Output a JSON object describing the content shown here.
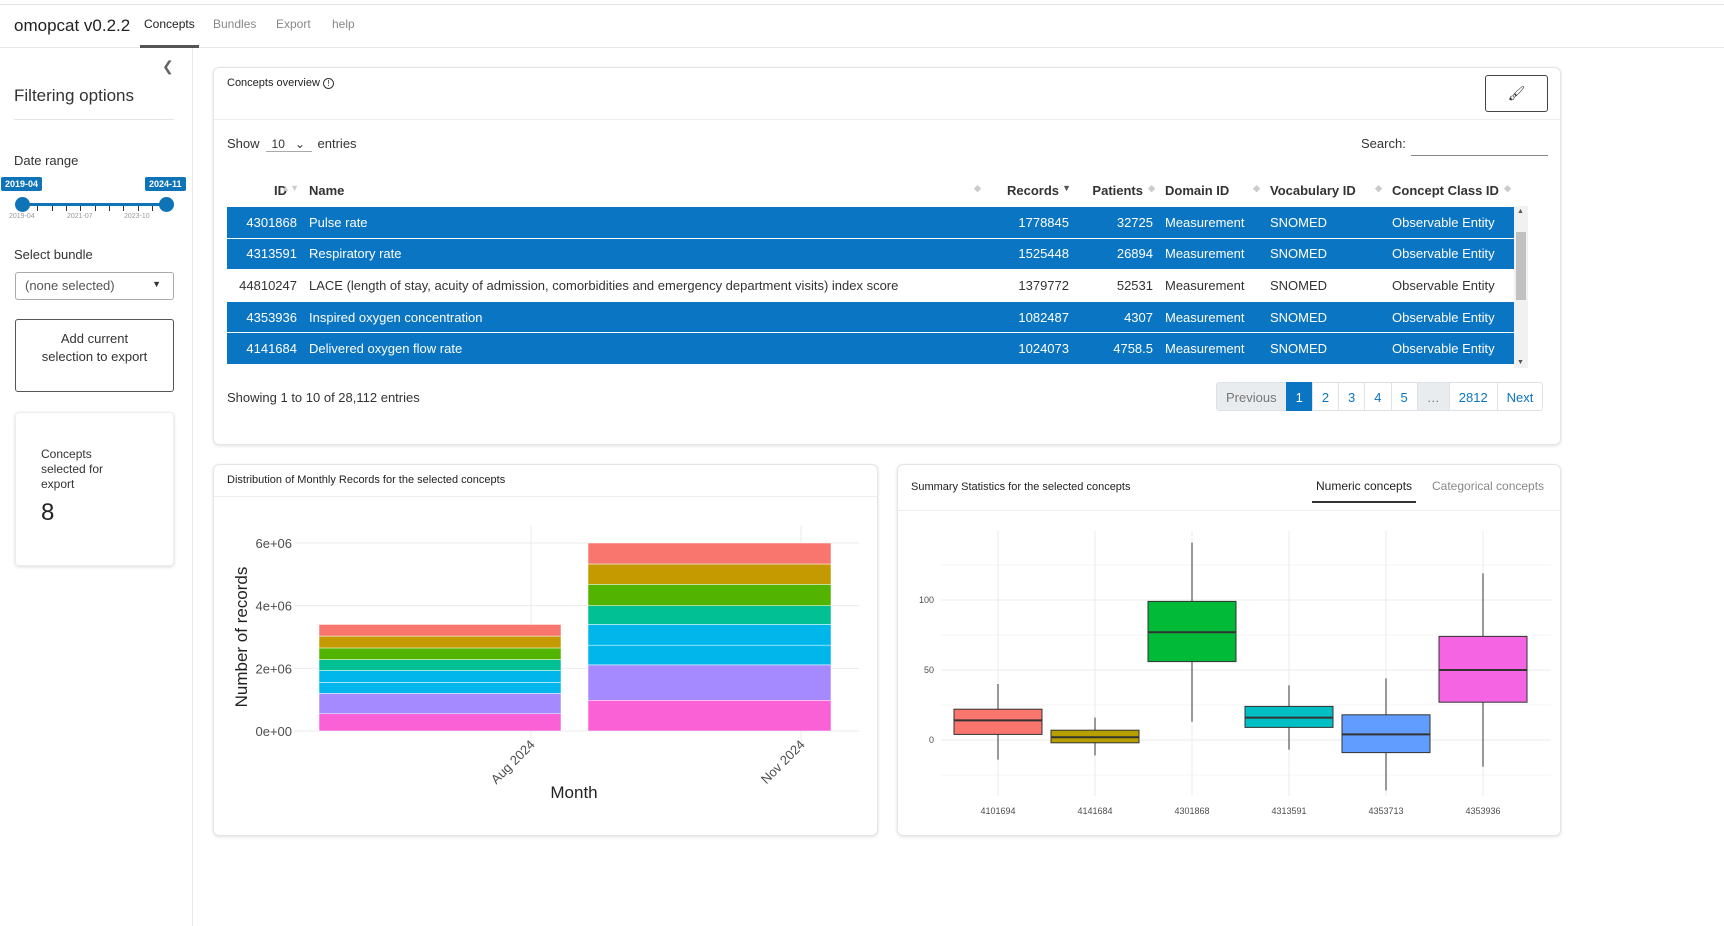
{
  "app": {
    "title": "omopcat v0.2.2",
    "tabs": [
      "Concepts",
      "Bundles",
      "Export",
      "help"
    ],
    "active_tab": "Concepts"
  },
  "sidebar": {
    "collapse_icon": "chevron-left-icon",
    "title": "Filtering options",
    "date_range": {
      "label": "Date range",
      "start": "2019-04",
      "end": "2024-11",
      "ticks": [
        "2019-04",
        "2021-07",
        "2023-10"
      ]
    },
    "bundle": {
      "label": "Select bundle",
      "value": "(none selected)"
    },
    "add_button": "Add current selection to export",
    "selected_box": {
      "title": "Concepts selected for export",
      "value": "8"
    }
  },
  "overview": {
    "title": "Concepts overview",
    "info_icon": "info-circle-icon",
    "brush_icon": "paintbrush-icon",
    "show_label": "Show",
    "entries_value": "10",
    "entries_label": "entries",
    "search_label": "Search:",
    "search_value": "",
    "columns": [
      "ID",
      "Name",
      "Records",
      "Patients",
      "Domain ID",
      "Vocabulary ID",
      "Concept Class ID"
    ],
    "sorted_column": "Records",
    "rows": [
      {
        "id": "4301868",
        "name": "Pulse rate",
        "records": "1778845",
        "patients": "32725",
        "domain": "Measurement",
        "vocab": "SNOMED",
        "class": "Observable Entity",
        "selected": true
      },
      {
        "id": "4313591",
        "name": "Respiratory rate",
        "records": "1525448",
        "patients": "26894",
        "domain": "Measurement",
        "vocab": "SNOMED",
        "class": "Observable Entity",
        "selected": true
      },
      {
        "id": "44810247",
        "name": "LACE (length of stay, acuity of admission, comorbidities and emergency department visits) index score",
        "records": "1379772",
        "patients": "52531",
        "domain": "Measurement",
        "vocab": "SNOMED",
        "class": "Observable Entity",
        "selected": false
      },
      {
        "id": "4353936",
        "name": "Inspired oxygen concentration",
        "records": "1082487",
        "patients": "4307",
        "domain": "Measurement",
        "vocab": "SNOMED",
        "class": "Observable Entity",
        "selected": true
      },
      {
        "id": "4141684",
        "name": "Delivered oxygen flow rate",
        "records": "1024073",
        "patients": "4758.5",
        "domain": "Measurement",
        "vocab": "SNOMED",
        "class": "Observable Entity",
        "selected": true
      }
    ],
    "info_text": "Showing 1 to 10 of 28,112 entries",
    "pager": {
      "previous": "Previous",
      "pages": [
        "1",
        "2",
        "3",
        "4",
        "5",
        "…",
        "2812"
      ],
      "current": "1",
      "next": "Next"
    },
    "selected_color": "#0a75c2"
  },
  "distribution": {
    "title": "Distribution of Monthly Records for the selected concepts"
  },
  "summary": {
    "title": "Summary Statistics for the selected concepts",
    "tabs": [
      "Numeric concepts",
      "Categorical concepts"
    ],
    "active_tab": "Numeric concepts"
  },
  "chart_data": [
    {
      "type": "bar",
      "stacked": true,
      "xlabel": "Month",
      "ylabel": "Number of records",
      "ylim": [
        0,
        6000000
      ],
      "yticks": [
        "0e+00",
        "2e+06",
        "4e+06",
        "6e+06"
      ],
      "ytick_values": [
        0,
        2000000,
        4000000,
        6000000
      ],
      "categories": [
        "Aug 2024",
        "Nov 2024"
      ],
      "colors": [
        "#f8766d",
        "#c49a00",
        "#53b400",
        "#00c094",
        "#00b6eb",
        "#00b6eb",
        "#a58aff",
        "#fb61d7"
      ],
      "series": [
        {
          "values": [
            370000,
            670000
          ]
        },
        {
          "values": [
            380000,
            650000
          ]
        },
        {
          "values": [
            370000,
            680000
          ]
        },
        {
          "values": [
            350000,
            600000
          ]
        },
        {
          "values": [
            380000,
            660000
          ]
        },
        {
          "values": [
            350000,
            630000
          ]
        },
        {
          "values": [
            650000,
            1130000
          ]
        },
        {
          "values": [
            550000,
            980000
          ]
        }
      ],
      "grid": true,
      "legend": "none"
    },
    {
      "type": "boxplot",
      "ylim": [
        -40,
        145
      ],
      "yticks": [
        0,
        50,
        100
      ],
      "grid": true,
      "legend": "none",
      "categories": [
        "4101694",
        "4141684",
        "4301868",
        "4313591",
        "4353713",
        "4353936"
      ],
      "colors": [
        "#f8766d",
        "#b79f00",
        "#00ba38",
        "#00bfc4",
        "#619cff",
        "#f564e3"
      ],
      "boxes": [
        {
          "min": -14,
          "q1": 4,
          "median": 14,
          "q3": 22,
          "max": 40
        },
        {
          "min": -11,
          "q1": -2,
          "median": 2,
          "q3": 7,
          "max": 16
        },
        {
          "min": 13,
          "q1": 56,
          "median": 77,
          "q3": 99,
          "max": 141
        },
        {
          "min": -7,
          "q1": 9,
          "median": 16,
          "q3": 24,
          "max": 39
        },
        {
          "min": -36,
          "q1": -9,
          "median": 4,
          "q3": 18,
          "max": 44
        },
        {
          "min": -19,
          "q1": 27,
          "median": 50,
          "q3": 74,
          "max": 119
        }
      ]
    }
  ]
}
